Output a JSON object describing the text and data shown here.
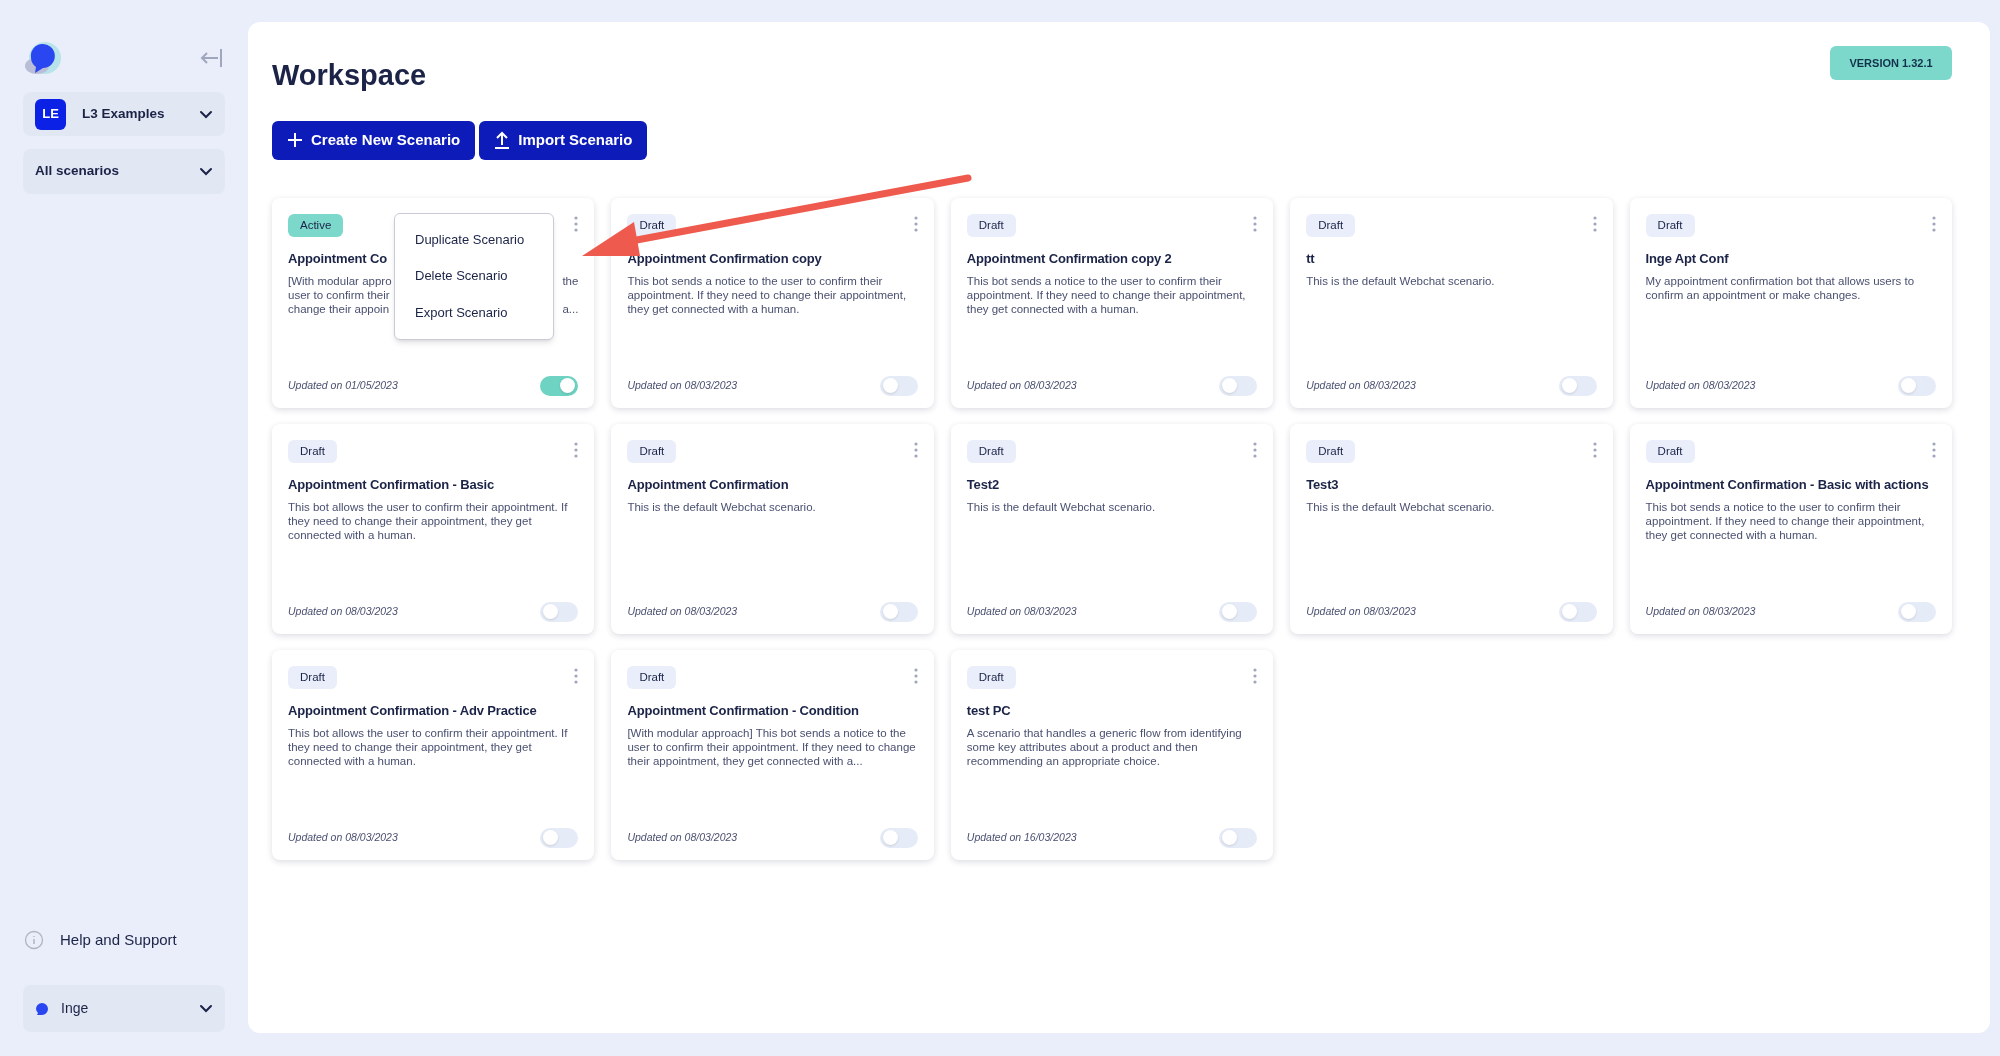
{
  "sidebar": {
    "workspace": {
      "initials": "LE",
      "name": "L3 Examples"
    },
    "filter": "All scenarios",
    "help": "Help and Support",
    "user": "Inge"
  },
  "page": {
    "title": "Workspace",
    "version": "VERSION 1.32.1",
    "buttons": [
      {
        "label": "Create New Scenario",
        "kind": "create"
      },
      {
        "label": "Import Scenario",
        "kind": "import"
      }
    ]
  },
  "scenarios": [
    {
      "status": "Active",
      "color": "#7dd8cc",
      "title": "Appointment Co",
      "description_lines": [
        [
          "[With modular appro",
          "the"
        ],
        [
          "user to confirm their"
        ],
        [
          "change their appoin",
          "a..."
        ]
      ],
      "updated": "Updated on 01/05/2023",
      "on": true,
      "menu_open": true
    },
    {
      "status": "Draft",
      "color": "#e9eefa",
      "title": "Appointment Confirmation copy",
      "description": "This bot sends a notice to the user to confirm their appointment. If they need to change their appointment, they get connected with a human.",
      "updated": "Updated on 08/03/2023",
      "on": false,
      "menu_open": false
    },
    {
      "status": "Draft",
      "color": "#e9eefa",
      "title": "Appointment Confirmation copy 2",
      "description": "This bot sends a notice to the user to confirm their appointment. If they need to change their appointment, they get connected with a human.",
      "updated": "Updated on 08/03/2023",
      "on": false,
      "menu_open": false
    },
    {
      "status": "Draft",
      "color": "#e9eefa",
      "title": "tt",
      "description": "This is the default Webchat scenario.",
      "updated": "Updated on 08/03/2023",
      "on": false,
      "menu_open": false
    },
    {
      "status": "Draft",
      "color": "#e9eefa",
      "title": "Inge Apt Conf",
      "description": "My appointment confirmation bot that allows users to confirm an appointment or make changes.",
      "updated": "Updated on 08/03/2023",
      "on": false,
      "menu_open": false
    },
    {
      "status": "Draft",
      "color": "#e9eefa",
      "title": "Appointment Confirmation - Basic",
      "description": "This bot allows the user to confirm their appointment. If they need to change their appointment, they get connected with a human.",
      "updated": "Updated on 08/03/2023",
      "on": false,
      "menu_open": false
    },
    {
      "status": "Draft",
      "color": "#e9eefa",
      "title": "Appointment Confirmation",
      "description": "This is the default Webchat scenario.",
      "updated": "Updated on 08/03/2023",
      "on": false,
      "menu_open": false
    },
    {
      "status": "Draft",
      "color": "#e9eefa",
      "title": "Test2",
      "description": "This is the default Webchat scenario.",
      "updated": "Updated on 08/03/2023",
      "on": false,
      "menu_open": false
    },
    {
      "status": "Draft",
      "color": "#e9eefa",
      "title": "Test3",
      "description": "This is the default Webchat scenario.",
      "updated": "Updated on 08/03/2023",
      "on": false,
      "menu_open": false
    },
    {
      "status": "Draft",
      "color": "#e9eefa",
      "title": "Appointment Confirmation - Basic with actions",
      "description": "This bot sends a notice to the user to confirm their appointment. If they need to change their appointment, they get connected with a human.",
      "updated": "Updated on 08/03/2023",
      "on": false,
      "menu_open": false
    },
    {
      "status": "Draft",
      "color": "#e9eefa",
      "title": "Appointment Confirmation - Adv Practice",
      "description": "This bot allows the user to confirm their appointment. If they need to change their appointment, they get connected with a human.",
      "updated": "Updated on 08/03/2023",
      "on": false,
      "menu_open": false
    },
    {
      "status": "Draft",
      "color": "#e9eefa",
      "title": "Appointment Confirmation - Condition",
      "description": "[With modular approach] This bot sends a notice to the user to confirm their appointment. If they need to change their appointment, they get connected with a...",
      "updated": "Updated on 08/03/2023",
      "on": false,
      "menu_open": false
    },
    {
      "status": "Draft",
      "color": "#e9eefa",
      "title": "test PC",
      "description": "A scenario that handles a generic flow from identifying some key attributes about a product and then recommending an appropriate choice.",
      "updated": "Updated on 16/03/2023",
      "on": false,
      "menu_open": false
    }
  ],
  "context_menu": {
    "items": [
      "Duplicate Scenario",
      "Delete Scenario",
      "Export Scenario"
    ]
  }
}
